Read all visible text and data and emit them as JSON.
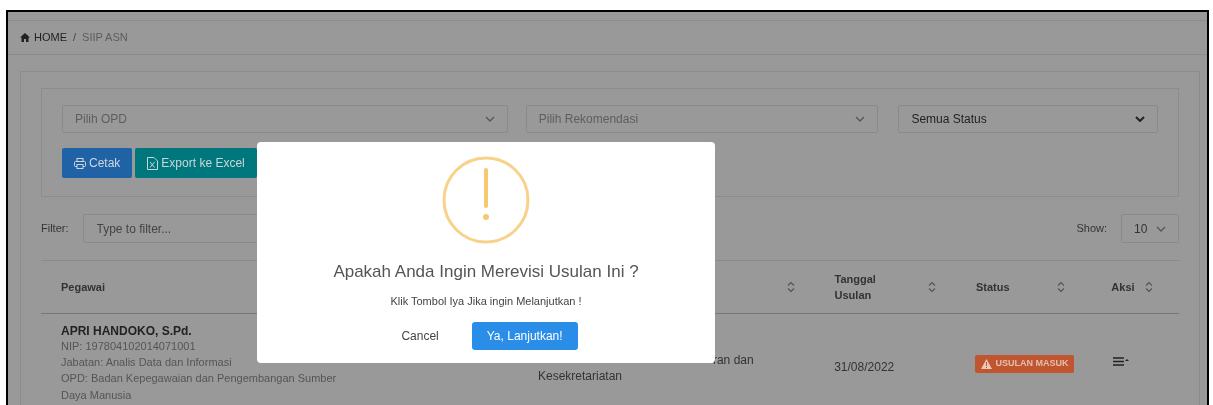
{
  "breadcrumb": {
    "home": "HOME",
    "separator": "/",
    "current": "SIIP ASN"
  },
  "selects": [
    {
      "placeholder": "Pilih OPD"
    },
    {
      "placeholder": "Pilih Rekomendasi"
    },
    {
      "value": "Semua Status"
    }
  ],
  "actions": [
    {
      "kind": "print",
      "label": "Cetak"
    },
    {
      "kind": "excel",
      "label": "Export ke Excel"
    }
  ],
  "filter": {
    "label": "Filter:",
    "placeholder": "Type to filter..."
  },
  "show": {
    "label": "Show:",
    "value": "10"
  },
  "table": {
    "columns": [
      {
        "label": "Pegawai",
        "sortable": false
      },
      {
        "sortable": true
      },
      {
        "label": "Tanggal Usulan",
        "sortable": true
      },
      {
        "label": "Status",
        "sortable": true
      },
      {
        "label": "Aksi",
        "sortable": true
      }
    ],
    "rows": [
      {
        "name": "APRI HANDOKO, S.Pd.",
        "nip": "NIP: 197804102014071001",
        "jabatan": "Jabatan: Analis Data dan Informasi",
        "opd": "OPD: Badan Kepegawaian dan Pengembangan Sumber Daya Manusia",
        "column_2": [
          "ran dan",
          "Kesekretariatan"
        ],
        "tanggal": "31/08/2022",
        "status": "USULAN MASUK"
      }
    ]
  },
  "dialog": {
    "title": "Apakah Anda Ingin Merevisi Usulan Ini ?",
    "message": "Klik Tombol Iya Jika ingin Melanjutkan !",
    "cancel": "Cancel",
    "confirm": "Ya, Lanjutkan!"
  }
}
